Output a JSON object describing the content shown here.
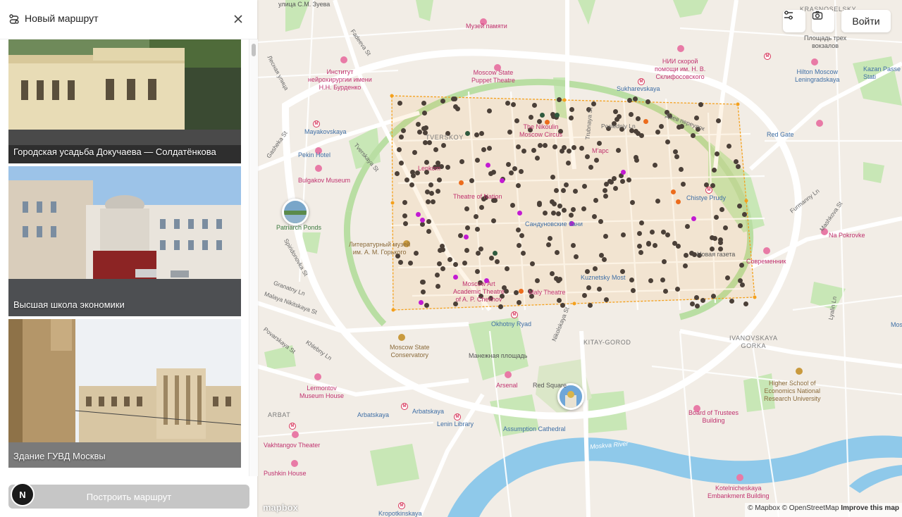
{
  "sidebar": {
    "title": "Новый маршрут",
    "cards": [
      {
        "label": "Городская усадьба Докучаева — Солдатёнкова"
      },
      {
        "label": "Высшая школа экономики"
      },
      {
        "label": "Здание ГУВД Москвы"
      }
    ],
    "build_button": "Построить маршрут",
    "avatar_letter": "N"
  },
  "header_buttons": {
    "login": "Войти",
    "filter_icon": "sliders-icon",
    "camera_icon": "camera-icon"
  },
  "map": {
    "labels": {
      "zueva": "улица С.М. Зуева",
      "muzey_pamyati": "Музей памяти",
      "krasnoselsky": "KRASNOSELSKY",
      "fadeeva": "Fadeeva St",
      "institut_burdenko": "Институт\nнейрохирургии имени\nН.Н. Бурденко",
      "sklif": "НИИ скорой\nпомощи им. Н. В.\nСклифосовского",
      "tri_vokzala": "Площадь трех\nвокзалов",
      "hilton": "Hilton Moscow\nLeningradskaya",
      "kazan": "Kazan Passe\nStati",
      "puppet": "Moscow State\nPuppet Theatre",
      "sukharevskaya": "Sukharevskaya",
      "lesnaya": "Лесная улица",
      "gasheka": "Gasheka St",
      "mayakovskaya": "Mayakovskaya",
      "pekin": "Pekin Hotel",
      "tverskaya_st": "Tverskaya St",
      "bulgakov": "Bulgakov Museum",
      "patriarch": "Patriarch Ponds",
      "spiridonovka": "Spiridonovka St",
      "granatny": "Granatny Ln",
      "malaya_nikitskaya": "Malaya Nikitskaya St",
      "povarskaya": "Povarskaya St",
      "khlebny": "Khlebny Ln",
      "conservatory": "Moscow State\nConservatory",
      "lermontov": "Lermontov\nMuseum House",
      "arbat": "ARBAT",
      "arbatskaya": "Arbatskaya",
      "arbatskaya2": "Arbatskaya",
      "vakhtangov": "Vakhtangov Theater",
      "pushkin_house": "Pushkin House",
      "kropotkinskaya": "Kropotkinskaya",
      "tverskoy": "TVERSKOY",
      "lenkom": "Lenkom",
      "nikulin": "The Nikoulin\nMoscow Circus",
      "mars": "М'арс",
      "trubnaya": "Trubnaya St",
      "posledny": "Posledniy Ln",
      "daev": "Даев переулок",
      "red_gate": "Red Gate",
      "chistye": "Chistye Prudy",
      "furmanny": "Furmanny Ln",
      "mashkova": "Mashkova St",
      "na_pokrovke": "Na Pokrovke",
      "novaya_gazeta": "Новая газета",
      "sovremennik": "Современник",
      "theatre_of_nation": "Theatre of Nation",
      "sandunovskie": "Сандуновские бани",
      "lit_museum": "Литературный музей\nим. А. М. Горького",
      "chekhov": "Moscow Art\nAcademic Theatre\nof A. P. Chekhov",
      "maly": "Maly Theatre",
      "kuznetsky": "Kuznetsky Most",
      "okhotny": "Okhotny Ryad",
      "nikolskaya": "Nikolskaya St",
      "kitay": "KITAY-GOROD",
      "manezh": "Манежная площадь",
      "arsenal": "Arsenal",
      "red_square": "Red Square",
      "lenin_library": "Lenin Library",
      "assumption": "Assumption Cathedral",
      "moskva_river": "Moskva River",
      "ivanovskaya": "IVANOVSKAYA\nGORKA",
      "hse": "Higher School of\nEconomics National\nResearch University",
      "board": "Board of Trustees\nBuilding",
      "kotelnicheskaya": "Kotelnicheskaya\nEmbankment Building",
      "lyalin": "Lyalin Ln",
      "mos": "Mos"
    }
  },
  "attribution": {
    "mapbox": "© Mapbox",
    "osm": "© OpenStreetMap",
    "improve": "Improve this map",
    "logo": "mapbox"
  },
  "colors": {
    "poi_dark": "#4b4038",
    "poi_magenta": "#c21ad2",
    "poi_orange": "#ec6c1c",
    "poi_green": "#2f5a3e",
    "selection": "#f4a01c",
    "water": "#8fc9ea",
    "park": "#c8e7b6"
  }
}
